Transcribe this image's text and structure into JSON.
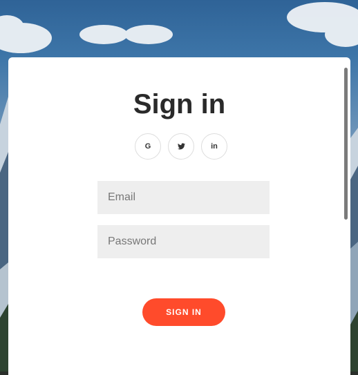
{
  "form": {
    "title": "Sign in",
    "social": [
      {
        "icon": "google-icon",
        "glyph": "G"
      },
      {
        "icon": "twitter-icon",
        "glyph": ""
      },
      {
        "icon": "linkedin-icon",
        "glyph": "in"
      }
    ],
    "email": {
      "placeholder": "Email",
      "value": ""
    },
    "password": {
      "placeholder": "Password",
      "value": ""
    },
    "submit_label": "SIGN IN"
  },
  "colors": {
    "accent": "#ff4b2b",
    "input_bg": "#eeeeee",
    "title": "#2a2a2a",
    "card_bg": "#ffffff"
  }
}
